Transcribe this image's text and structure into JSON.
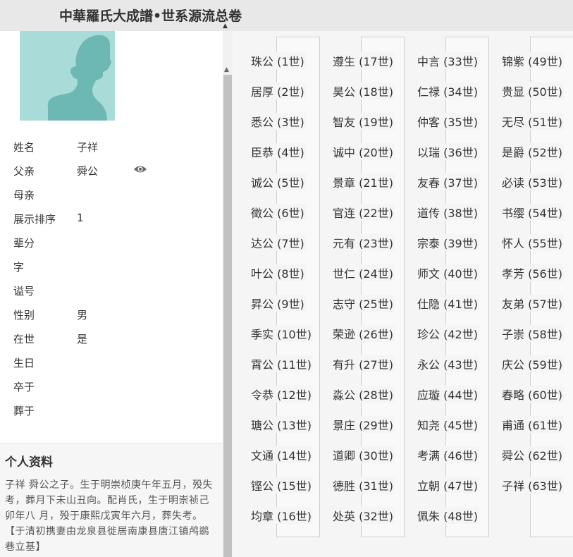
{
  "header": {
    "title": "中華羅氏大成譜•世系源流总卷",
    "arrow": "▲"
  },
  "person": {
    "rows": [
      {
        "label": "姓名",
        "value": "子祥"
      },
      {
        "label": "父亲",
        "value": "舜公"
      },
      {
        "label": "母亲",
        "value": ""
      },
      {
        "label": "展示排序",
        "value": "1"
      },
      {
        "label": "辈分",
        "value": ""
      },
      {
        "label": "字",
        "value": ""
      },
      {
        "label": "谥号",
        "value": ""
      },
      {
        "label": "性别",
        "value": "男"
      },
      {
        "label": "在世",
        "value": "是"
      },
      {
        "label": "生日",
        "value": ""
      },
      {
        "label": "卒于",
        "value": ""
      },
      {
        "label": "葬于",
        "value": ""
      }
    ]
  },
  "profile": {
    "title": "个人资料",
    "text": "子祥  舜公之子。生于明崇桢庚午年五月，殁失考，葬月下未山丑向。配肖氏，生于明崇祯己卯年八  月，殁于康熙戊寅年六月，葬失考。【于清初携妻由龙泉县徙居南康县唐江镇鸬鹚巷立基】"
  },
  "scrollbar": {
    "up": "▲"
  },
  "generations": [
    [
      "珠公 (1世)",
      "居厚 (2世)",
      "悉公 (3世)",
      "臣恭 (4世)",
      "诚公 (5世)",
      "徵公 (6世)",
      "达公 (7世)",
      "叶公 (8世)",
      "昇公 (9世)",
      "季实 (10世)",
      "霄公 (11世)",
      "令恭 (12世)",
      "瑭公 (13世)",
      "文通 (14世)",
      "铿公 (15世)",
      "均章 (16世)"
    ],
    [
      "遵生 (17世)",
      "昊公 (18世)",
      "智友 (19世)",
      "诚中 (20世)",
      "景章 (21世)",
      "官连 (22世)",
      "元有 (23世)",
      "世仁 (24世)",
      "志守 (25世)",
      "荣逊 (26世)",
      "有升 (27世)",
      "淼公 (28世)",
      "景庄 (29世)",
      "道卿 (30世)",
      "德胜 (31世)",
      "处英 (32世)"
    ],
    [
      "中言 (33世)",
      "仁禄 (34世)",
      "仲客 (35世)",
      "以瑞 (36世)",
      "友春 (37世)",
      "道传 (38世)",
      "宗泰 (39世)",
      "师文 (40世)",
      "仕隐 (41世)",
      "珍公 (42世)",
      "永公 (43世)",
      "应璇 (44世)",
      "知尧 (45世)",
      "考满 (46世)",
      "立朝 (47世)",
      "佩朱 (48世)"
    ],
    [
      "锦紫 (49世)",
      "贵显 (50世)",
      "无尽 (51世)",
      "是爵 (52世)",
      "必读 (53世)",
      "书缨 (54世)",
      "怀人 (55世)",
      "孝芳 (56世)",
      "友弟 (57世)",
      "子崇 (58世)",
      "庆公 (59世)",
      "春略 (60世)",
      "甫通 (61世)",
      "舜公 (62世)",
      "子祥 (63世)"
    ]
  ]
}
